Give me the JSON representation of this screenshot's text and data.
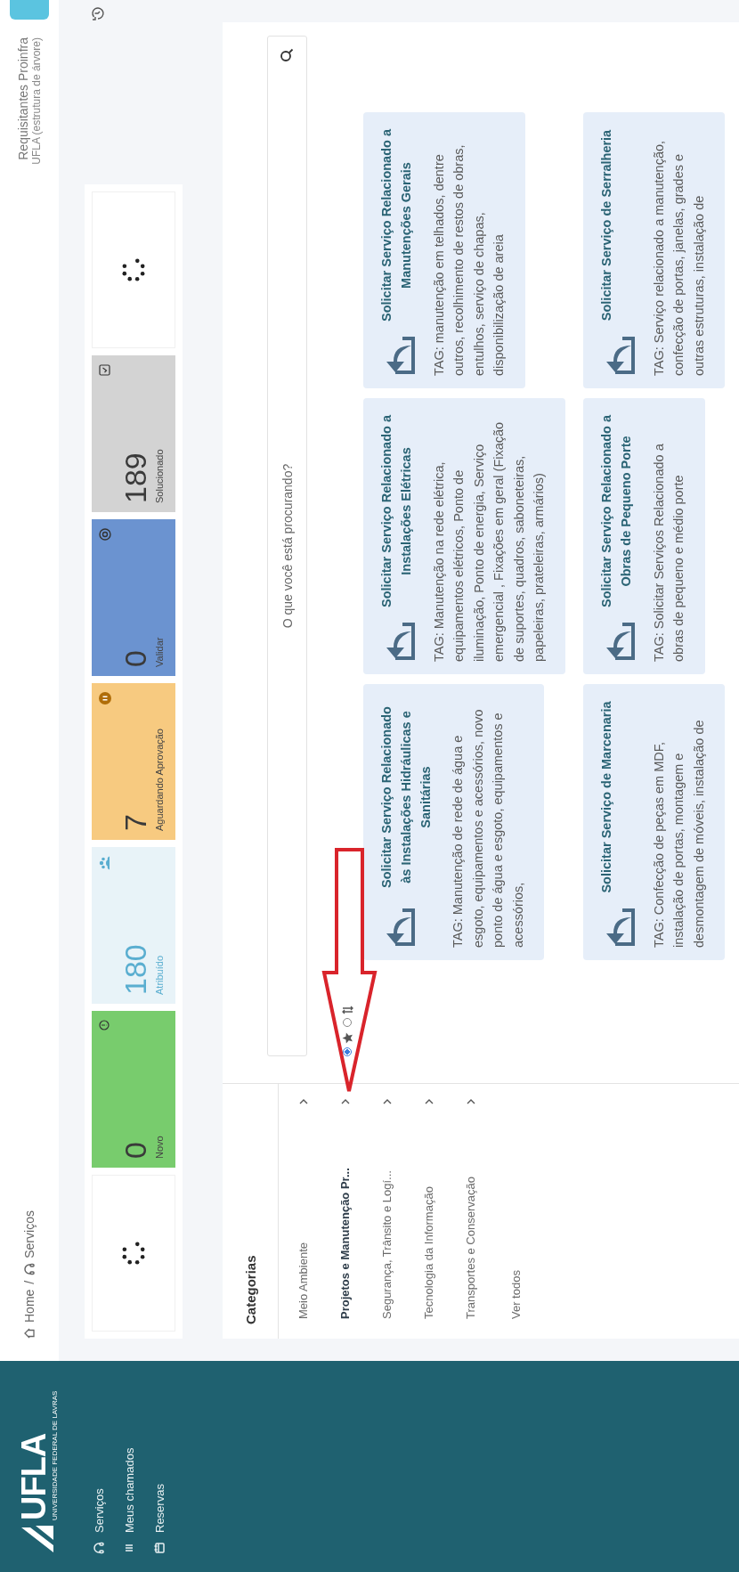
{
  "sidebar": {
    "logo": {
      "text": "UFLA",
      "subtitle": "UNIVERSIDADE FEDERAL DE LAVRAS"
    },
    "items": [
      {
        "label": "Serviços",
        "kind": "headset"
      },
      {
        "label": "Meus chamados",
        "kind": "list"
      },
      {
        "label": "Reservas",
        "kind": "calendar"
      }
    ]
  },
  "breadcrumb": {
    "items": [
      {
        "label": "Home",
        "kind": "home"
      },
      {
        "label": "Serviços",
        "kind": "headset"
      }
    ],
    "separator": "/"
  },
  "user": {
    "name": "Requisitantes Proinfra",
    "unit": "UFLA (estrutura de árvore)"
  },
  "stats": [
    {
      "kind": "loading"
    },
    {
      "kind": "new",
      "value": "0",
      "label": "Novo",
      "color": "#78cc6d"
    },
    {
      "kind": "assigned",
      "value": "180",
      "label": "Atribuído",
      "color": "#e8f3f8"
    },
    {
      "kind": "pending",
      "value": "7",
      "label": "Aguardando Aprovação",
      "color": "#f7ca80"
    },
    {
      "kind": "validate",
      "value": "0",
      "label": "Validar",
      "color": "#6b93d0"
    },
    {
      "kind": "solved",
      "value": "189",
      "label": "Solucionado",
      "color": "#d3d3d3"
    },
    {
      "kind": "loading"
    }
  ],
  "search": {
    "placeholder": "O que você está procurando?"
  },
  "filters": [
    {
      "kind": "star",
      "selected": true
    },
    {
      "kind": "sort",
      "selected": false
    }
  ],
  "categories": {
    "title": "Categorias",
    "items": [
      {
        "label": "Meio Ambiente",
        "selected": false
      },
      {
        "label": "Projetos e Manutenção Pr...",
        "selected": true
      },
      {
        "label": "Segurança, Trânsito e Logí...",
        "selected": false
      },
      {
        "label": "Tecnologia da Informação",
        "selected": false
      },
      {
        "label": "Transportes e Conservação",
        "selected": false
      }
    ],
    "see_all": "Ver todos"
  },
  "services": [
    {
      "title": "Solicitar Serviço Relacionado às Instalações Hidráulicas e Sanitárias",
      "description": "TAG: Manutenção de rede de água e esgoto, equipamentos e acessórios, novo ponto de água e esgoto, equipamentos e acessórios,"
    },
    {
      "title": "Solicitar Serviço Relacionado a Instalações Elétricas",
      "description": "TAG: Manutenção na rede elétrica, equipamentos elétricos, Ponto de iluminação, Ponto de energia, Serviço emergencial , Fixações em geral (Fixação de suportes, quadros, saboneteiras, papeleiras, prateleiras, armários)"
    },
    {
      "title": "Solicitar Serviço Relacionado a Manutenções Gerais",
      "description": "TAG: manutenção em telhados, dentre outros, recolhimento de restos de obras, entulhos, serviço de chapas, disponibilização de areia"
    },
    {
      "title": "Solicitar Serviço de Marcenaria",
      "description": "TAG: Confecção de peças em MDF, instalação de portas, montagem e desmontagem de móveis, instalação de"
    },
    {
      "title": "Solicitar Serviço Relacionado a Obras de Pequeno Porte",
      "description": "TAG: Solicitar Serviços Relacionado a obras de pequeno e médio porte"
    },
    {
      "title": "Solicitar Serviço de Serralheria",
      "description": "TAG: Serviço relacionado a manutenção, confecção de portas, janelas, grades e outras estruturas, instalação de"
    }
  ]
}
